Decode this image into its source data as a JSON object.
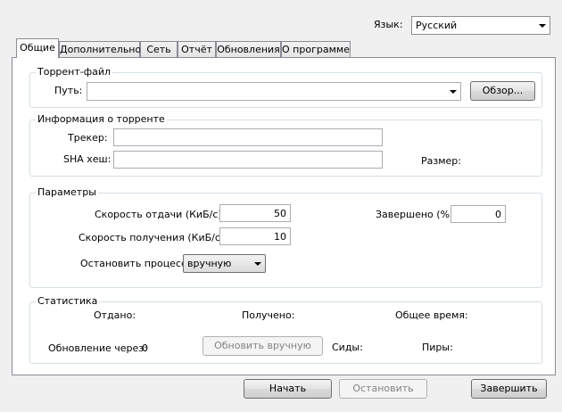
{
  "language": {
    "label": "Язык:",
    "value": "Русский"
  },
  "tabs": [
    "Общие",
    "Дополнительно",
    "Сеть",
    "Отчёт",
    "Обновления",
    "О программе"
  ],
  "torrent_file": {
    "title": "Торрент-файл",
    "path_label": "Путь:",
    "path_value": "",
    "browse_label": "Обзор..."
  },
  "torrent_info": {
    "title": "Информация о торренте",
    "tracker_label": "Трекер:",
    "tracker_value": "",
    "sha_label": "SHA хеш:",
    "sha_value": "",
    "size_label": "Размер:"
  },
  "params": {
    "title": "Параметры",
    "upload_label": "Скорость отдачи (КиБ/с):",
    "upload_value": "50",
    "download_label": "Скорость получения (КиБ/с):",
    "download_value": "10",
    "stop_label": "Остановить процесс",
    "stop_value": "вручную",
    "completed_label": "Завершено (%)",
    "completed_value": "0"
  },
  "stats": {
    "title": "Статистика",
    "uploaded_label": "Отдано:",
    "received_label": "Получено:",
    "total_time_label": "Общее время:",
    "update_label": "Обновление через:",
    "update_value": "0",
    "update_button": "Обновить вручную",
    "seeds_label": "Сиды:",
    "peers_label": "Пиры:"
  },
  "footer": {
    "start": "Начать",
    "stop": "Остановить",
    "finish": "Завершить"
  }
}
